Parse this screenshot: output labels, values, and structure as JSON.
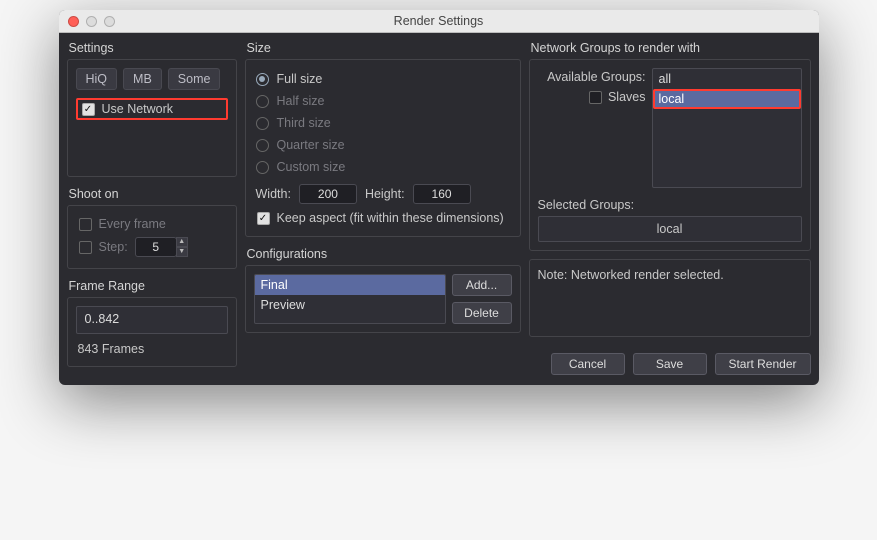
{
  "window": {
    "title": "Render Settings"
  },
  "settings": {
    "label": "Settings",
    "presets": [
      "HiQ",
      "MB",
      "Some"
    ],
    "use_network_label": "Use Network",
    "use_network_checked": true
  },
  "shoot_on": {
    "label": "Shoot on",
    "every_frame_label": "Every frame",
    "step_label": "Step:",
    "step_value": "5"
  },
  "frame_range": {
    "label": "Frame Range",
    "range_text": "0..842",
    "count_text": "843 Frames"
  },
  "size": {
    "label": "Size",
    "options": [
      "Full size",
      "Half size",
      "Third size",
      "Quarter size",
      "Custom size"
    ],
    "selected_index": 0,
    "width_label": "Width:",
    "height_label": "Height:",
    "width_value": "200",
    "height_value": "160",
    "keep_aspect_label": "Keep aspect (fit within these dimensions)",
    "keep_aspect_checked": true
  },
  "configurations": {
    "label": "Configurations",
    "items": [
      "Final",
      "Preview"
    ],
    "selected_index": 0,
    "add_label": "Add...",
    "delete_label": "Delete"
  },
  "network": {
    "label": "Network Groups to render with",
    "available_label": "Available Groups:",
    "slaves_label": "Slaves",
    "available_items": [
      "all",
      "local"
    ],
    "available_selected_index": 1,
    "selected_label": "Selected Groups:",
    "selected_value": "local"
  },
  "note": {
    "text": "Note: Networked render selected."
  },
  "buttons": {
    "cancel": "Cancel",
    "save": "Save",
    "start": "Start Render"
  }
}
